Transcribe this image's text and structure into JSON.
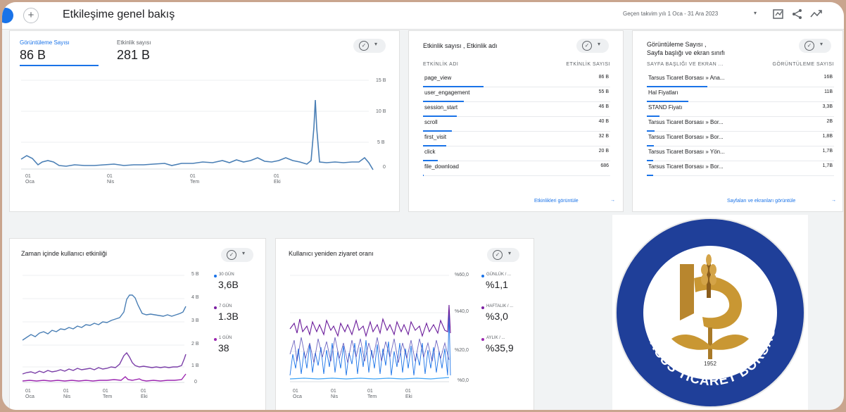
{
  "header": {
    "title": "Etkileşime genel bakış",
    "date_range": "Geçen takvim yılı  1 Oca - 31 Ara 2023",
    "date_caret": "▾"
  },
  "icons": {
    "plus": "+",
    "check": "✓",
    "caret": "▾",
    "arrow": "→"
  },
  "overview": {
    "metric1_label": "Görüntüleme Sayısı",
    "metric1_value": "86 B",
    "metric2_label": "Etkinlik sayısı",
    "metric2_value": "281 B",
    "y_ticks": [
      "15 B",
      "10 B",
      "5 B",
      "0"
    ],
    "x_ticks": [
      {
        "d": "01",
        "m": "Oca"
      },
      {
        "d": "01",
        "m": "Nis"
      },
      {
        "d": "01",
        "m": "Tem"
      },
      {
        "d": "01",
        "m": "Eki"
      }
    ]
  },
  "events_card": {
    "title": "Etkinlik sayısı , Etkinlik adı",
    "col1": "ETKİNLİK ADI",
    "col2": "ETKİNLİK SAYISI",
    "rows": [
      {
        "name": "page_view",
        "value": "86 B",
        "bar": 0.95
      },
      {
        "name": "user_engagement",
        "value": "55 B",
        "bar": 0.64
      },
      {
        "name": "session_start",
        "value": "46 B",
        "bar": 0.53
      },
      {
        "name": "scroll",
        "value": "40 B",
        "bar": 0.46
      },
      {
        "name": "first_visit",
        "value": "32 B",
        "bar": 0.37
      },
      {
        "name": "click",
        "value": "20 B",
        "bar": 0.23
      },
      {
        "name": "file_download",
        "value": "686",
        "bar": 0.01
      }
    ],
    "link": "Etkinlikleri görüntüle"
  },
  "pages_card": {
    "title_line1": "Görüntüleme Sayısı ,",
    "title_line2": "Sayfa başlığı ve ekran sınıfı",
    "col1": "SAYFA BAŞLIĞI VE EKRAN ...",
    "col2": "GÖRÜNTÜLEME SAYISI",
    "rows": [
      {
        "name": "Tarsus Ticaret Borsası » Ana...",
        "value": "16B",
        "bar": 0.95
      },
      {
        "name": "Hal Fiyatları",
        "value": "11B",
        "bar": 0.65
      },
      {
        "name": "STAND Fiyatı",
        "value": "3,3B",
        "bar": 0.2
      },
      {
        "name": "Tarsus Ticaret Borsası » Bor...",
        "value": "2B",
        "bar": 0.12
      },
      {
        "name": "Tarsus Ticaret Borsası » Bor...",
        "value": "1,8B",
        "bar": 0.11
      },
      {
        "name": "Tarsus Ticaret Borsası » Yön...",
        "value": "1,7B",
        "bar": 0.1
      },
      {
        "name": "Tarsus Ticaret Borsası » Bor...",
        "value": "1,7B",
        "bar": 0.1
      }
    ],
    "link": "Sayfaları ve ekranları görüntüle"
  },
  "activity_card": {
    "title": "Zaman içinde kullanıcı etkinliği",
    "y_ticks": [
      "5 B",
      "4 B",
      "3 B",
      "2 B",
      "1 B",
      "0"
    ],
    "legend": [
      {
        "label": "30 GÜN",
        "value": "3,6B",
        "color": "#1a73e8"
      },
      {
        "label": "7 GÜN",
        "value": "1.3B",
        "color": "#7b1fa2"
      },
      {
        "label": "1 GÜN",
        "value": "38",
        "color": "#9c27b0"
      }
    ],
    "x_ticks": [
      {
        "d": "01",
        "m": "Oca"
      },
      {
        "d": "01",
        "m": "Nis"
      },
      {
        "d": "01",
        "m": "Tem"
      },
      {
        "d": "01",
        "m": "Eki"
      }
    ]
  },
  "retention_card": {
    "title": "Kullanıcı yeniden ziyaret oranı",
    "y_ticks": [
      "%60,0",
      "%40,0",
      "%20,0",
      "%0,0"
    ],
    "legend": [
      {
        "label": "GÜNLÜK / ...",
        "value": "%1,1",
        "color": "#1a73e8"
      },
      {
        "label": "HAFTALIK / ...",
        "value": "%3,0",
        "color": "#7b1fa2"
      },
      {
        "label": "AYLIK / ...",
        "value": "%35,9",
        "color": "#9c27b0"
      }
    ],
    "x_ticks": [
      {
        "d": "01",
        "m": "Oca"
      },
      {
        "d": "01",
        "m": "Nis"
      },
      {
        "d": "01",
        "m": "Tem"
      },
      {
        "d": "01",
        "m": "Eki"
      }
    ]
  },
  "logo": {
    "text": "TARSUS TİCARET BORSASI",
    "year": "1952",
    "colors": {
      "ring": "#1f3f99",
      "gold": "#b8862e"
    }
  }
}
